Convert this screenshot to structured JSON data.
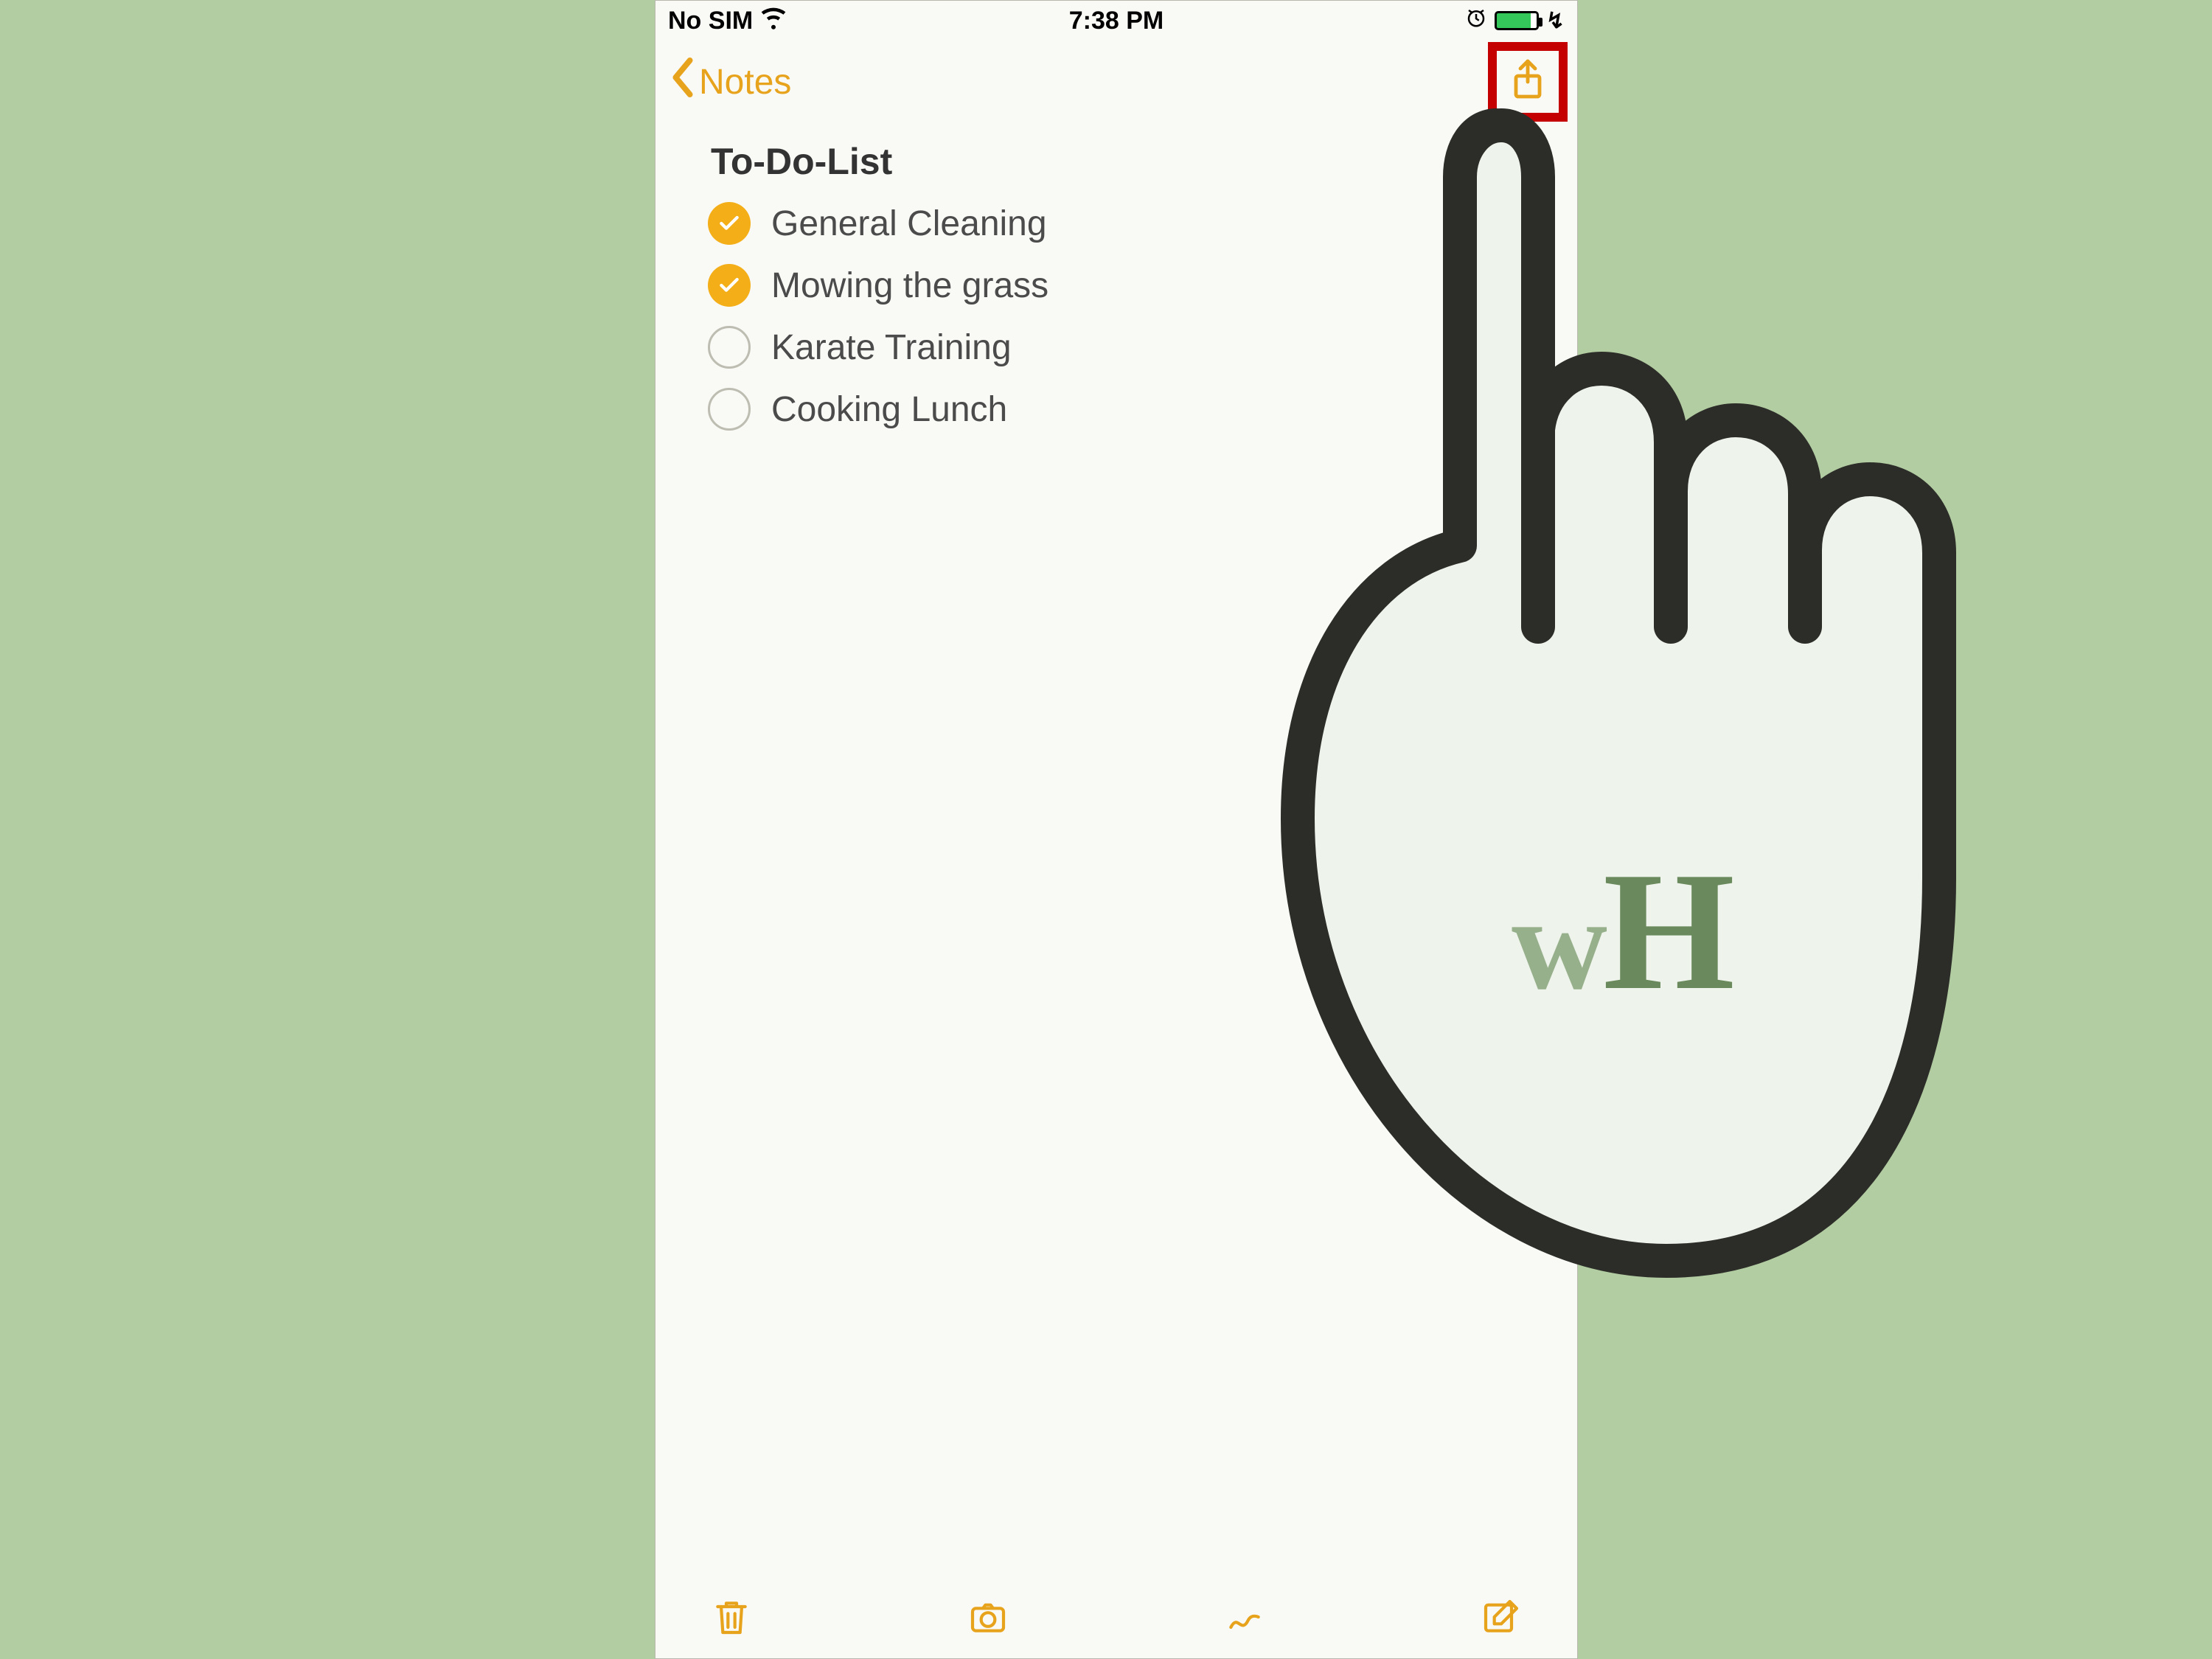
{
  "status_bar": {
    "carrier": "No SIM",
    "time": "7:38 PM",
    "charging_glyph": "↯"
  },
  "navbar": {
    "back_label": "Notes",
    "share_highlighted": true
  },
  "note": {
    "title": "To-Do-List",
    "items": [
      {
        "label": "General Cleaning",
        "checked": true
      },
      {
        "label": "Mowing the grass",
        "checked": true
      },
      {
        "label": "Karate Training",
        "checked": false
      },
      {
        "label": "Cooking Lunch",
        "checked": false
      }
    ]
  },
  "toolbar": {
    "icons": [
      "trash-icon",
      "camera-icon",
      "sketch-icon",
      "compose-icon"
    ]
  },
  "overlay": {
    "logo_w": "w",
    "logo_H": "H"
  },
  "colors": {
    "accent": "#e8a31c",
    "checkbox_checked": "#f4ae18",
    "highlight": "#c40000",
    "page_bg": "#b2cda1"
  }
}
